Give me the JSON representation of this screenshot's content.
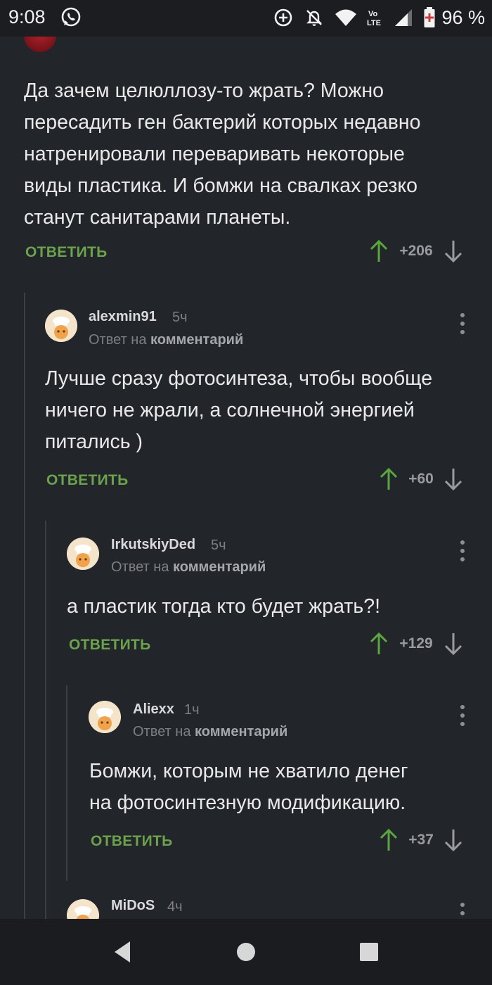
{
  "status_bar": {
    "time": "9:08",
    "battery_percent": "96 %",
    "icons": [
      "whatsapp-icon",
      "data-saver-icon",
      "bell-off-icon",
      "wifi-icon",
      "volte-icon",
      "signal-icon",
      "battery-icon"
    ]
  },
  "comments": [
    {
      "text": "Да зачем целюллозу-то жрать? Можно\nпересадить ген бактерий которых недавно\nнатренировали переваривать некоторые\nвиды пластика. И бомжи на свалках резко\nстанут санитарами планеты.",
      "reply_label": "ОТВЕТИТЬ",
      "score": "+206"
    },
    {
      "username": "alexmin91",
      "time": "5ч",
      "reply_to_prefix": "Ответ на",
      "reply_to_link": "комментарий",
      "text": "Лучше сразу фотосинтеза, чтобы вообще\nничего не жрали, а солнечной энергией\nпитались )",
      "reply_label": "ОТВЕТИТЬ",
      "score": "+60"
    },
    {
      "username": "IrkutskiyDed",
      "time": "5ч",
      "reply_to_prefix": "Ответ на",
      "reply_to_link": "комментарий",
      "text": "а пластик тогда кто будет жрать?!",
      "reply_label": "ОТВЕТИТЬ",
      "score": "+129"
    },
    {
      "username": "Aliexx",
      "time": "1ч",
      "reply_to_prefix": "Ответ на",
      "reply_to_link": "комментарий",
      "text": "Бомжи, которым не хватило денег\nна фотосинтезную модификацию.",
      "reply_label": "ОТВЕТИТЬ",
      "score": "+37"
    },
    {
      "username": "MiDoS",
      "time": "4ч"
    }
  ],
  "colors": {
    "background": "#22252a",
    "reply_green": "#6aa34b",
    "upvote_green": "#5aa83d",
    "muted_text": "#7d7f83"
  }
}
